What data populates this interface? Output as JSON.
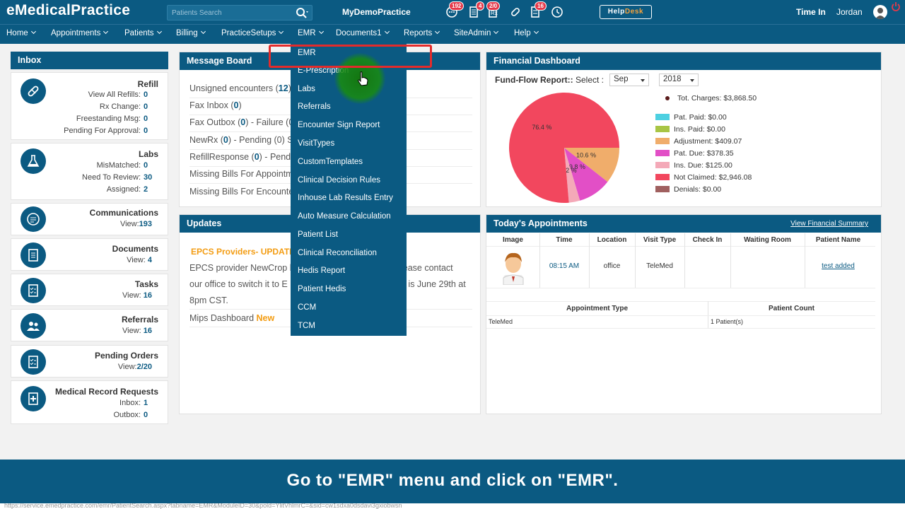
{
  "header": {
    "logo": "eMedicalPractice",
    "search_placeholder": "Patients Search",
    "practice_name": "MyDemoPractice",
    "badges": [
      "192",
      "4",
      "2/0",
      "16"
    ],
    "helpdesk_a": "Help",
    "helpdesk_b": "Desk",
    "time_in": "Time In",
    "user": "Jordan"
  },
  "nav": [
    "Home",
    "Appointments",
    "Patients",
    "Billing",
    "PracticeSetups",
    "EMR",
    "Documents1",
    "Reports",
    "SiteAdmin",
    "Help"
  ],
  "inbox": {
    "title": "Inbox",
    "refill": {
      "title": "Refill",
      "rows": [
        {
          "label": "View All Refills:",
          "value": "0"
        },
        {
          "label": "Rx Change:",
          "value": "0"
        },
        {
          "label": "Freestanding Msg:",
          "value": "0"
        },
        {
          "label": "Pending For Approval:",
          "value": "0"
        }
      ]
    },
    "labs": {
      "title": "Labs",
      "rows": [
        {
          "label": "MisMatched:",
          "value": "0"
        },
        {
          "label": "Need To Review:",
          "value": "30"
        },
        {
          "label": "Assigned:",
          "value": "2"
        }
      ]
    },
    "communications": {
      "title": "Communications",
      "label": "View:",
      "value": "193"
    },
    "documents": {
      "title": "Documents",
      "label": "View:",
      "value": "4"
    },
    "tasks": {
      "title": "Tasks",
      "label": "View:",
      "value": "16"
    },
    "referrals": {
      "title": "Referrals",
      "label": "View:",
      "value": "16"
    },
    "pending_orders": {
      "title": "Pending Orders",
      "label": "View:",
      "value": "2/20"
    },
    "medical_records": {
      "title": "Medical Record Requests",
      "rows": [
        {
          "label": "Inbox:",
          "value": "1"
        },
        {
          "label": "Outbox:",
          "value": "0"
        }
      ]
    }
  },
  "message_board": {
    "title": "Message Board",
    "rows": [
      {
        "pre": "Unsigned encounters (",
        "val": "12",
        "post": ")"
      },
      {
        "pre": "Fax Inbox (",
        "val": "0",
        "post": ")"
      },
      {
        "pre": "Fax Outbox (",
        "val": "0",
        "post": ") - Failure (0"
      },
      {
        "pre": "NewRx (",
        "val": "0",
        "post": ") - Pending (0)  S"
      },
      {
        "pre": "RefillResponse (",
        "val": "0",
        "post": ") - Pendi"
      },
      {
        "pre": "Missing Bills For Appointm",
        "val": "",
        "post": ""
      },
      {
        "pre": "Missing Bills For Encounte",
        "val": "",
        "post": ""
      }
    ]
  },
  "updates": {
    "title": "Updates",
    "headline": "EPCS Providers- UPDATE",
    "line1_a": "EPCS provider NewCrop h",
    "line1_b": "lease contact",
    "line2_a": "our office to switch it to E",
    "line2_b": "n is June 29th at",
    "line3": "8pm CST.",
    "mips": "Mips Dashboard",
    "new_tag": "New"
  },
  "emr_menu": [
    "EMR",
    "E-Prescription",
    "Labs",
    "Referrals",
    "Encounter Sign Report",
    "VisitTypes",
    "CustomTemplates",
    "Clinical Decision Rules",
    "Inhouse Lab Results Entry",
    "Auto Measure Calculation",
    "Patient List",
    "Clinical Reconciliation",
    "Hedis Report",
    "Patient Hedis",
    "CCM",
    "TCM"
  ],
  "financial": {
    "title": "Financial Dashboard",
    "fund_flow": "Fund-Flow Report::",
    "select_label": "Select :",
    "month": "Sep",
    "year": "2018",
    "total": "Tot. Charges: $3,868.50"
  },
  "chart_data": {
    "type": "pie",
    "title": "",
    "labels": [
      "Pat. Paid",
      "Ins. Paid",
      "Adjustment",
      "Pat. Due",
      "Ins. Due",
      "Not Claimed",
      "Denials"
    ],
    "values": [
      0.0,
      0.0,
      409.07,
      378.35,
      125.0,
      2946.08,
      0.0
    ],
    "value_labels": [
      "Pat. Paid: $0.00",
      "Ins. Paid: $0.00",
      "Adjustment: $409.07",
      "Pat. Due: $378.35",
      "Ins. Due: $125.00",
      "Not Claimed: $2,946.08",
      "Denials: $0.00"
    ],
    "slice_labels": [
      "",
      "",
      "10.6 %",
      "9.8 %",
      "3.2 %",
      "76.4 %",
      ""
    ],
    "colors": [
      "#4dd0e1",
      "#a8c545",
      "#f0ad6b",
      "#e24fc6",
      "#f4a9b8",
      "#f2475e",
      "#a0605f"
    ],
    "legend": "right"
  },
  "appointments": {
    "title": "Today's Appointments",
    "summary_link": "View Financial Summary",
    "columns": [
      "Image",
      "Time",
      "Location",
      "Visit Type",
      "Check In",
      "Waiting Room",
      "Patient Name"
    ],
    "row": {
      "time": "08:15 AM",
      "location": "office",
      "visit_type": "TeleMed",
      "check_in": "",
      "waiting_room": "",
      "patient": "test added"
    },
    "summary_columns": [
      "Appointment Type",
      "Patient Count"
    ],
    "summary_row": {
      "type": "TeleMed",
      "count": "1 Patient(s)"
    }
  },
  "caption": "Go to \"EMR\" menu and click on \"EMR\".",
  "status_url": "https://service.emedpractice.com/emr/PatientSearch.aspx?tabname=EMR&ModuleID=30&pold=YlitVhlmrC=&sid=cw1sdxa0dsdavi3gxiobwsn"
}
